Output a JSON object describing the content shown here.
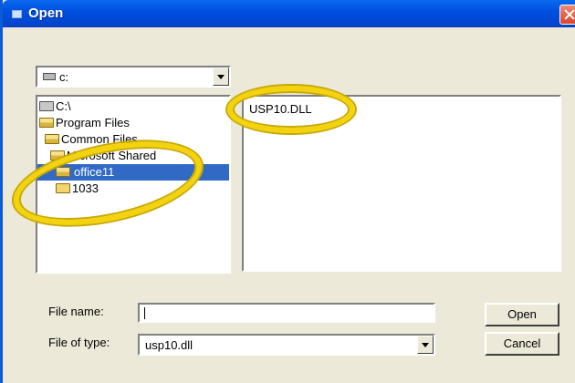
{
  "window": {
    "title": "Open"
  },
  "drive": {
    "selected": "c:"
  },
  "directories": [
    {
      "label": "C:\\",
      "icon": "drive-folder-icon",
      "indent": 0,
      "selected": false
    },
    {
      "label": "Program Files",
      "icon": "open-folder-icon",
      "indent": 0,
      "selected": false
    },
    {
      "label": "Common Files",
      "icon": "open-folder-icon",
      "indent": 1,
      "selected": false
    },
    {
      "label": "Microsoft Shared",
      "icon": "open-folder-icon",
      "indent": 2,
      "selected": false
    },
    {
      "label": "office11",
      "icon": "open-folder-icon",
      "indent": 3,
      "selected": true
    },
    {
      "label": "1033",
      "icon": "folder-icon",
      "indent": 3,
      "selected": false
    }
  ],
  "files": [
    "USP10.DLL"
  ],
  "file_name": {
    "label": "File name:",
    "value": ""
  },
  "file_type": {
    "label": "File of type:",
    "value": "usp10.dll"
  },
  "buttons": {
    "open": "Open",
    "cancel": "Cancel"
  },
  "colors": {
    "titlebar": "#0050e0",
    "selection": "#316ac5",
    "highlight_ellipse": "#f3d20e",
    "dialog_bg": "#ece9d8"
  }
}
